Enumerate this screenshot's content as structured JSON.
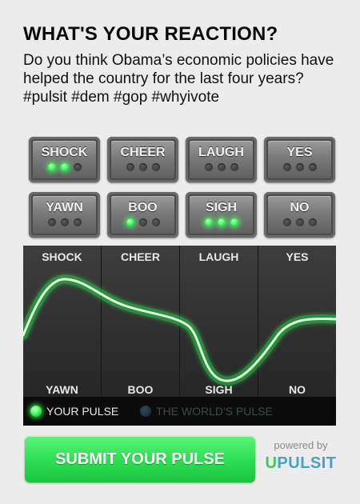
{
  "header": {
    "title": "WHAT'S YOUR REACTION?",
    "question": "Do you think Obama’s economic policies have helped the country for the last four years? #pulsit #dem #gop #whyivote"
  },
  "reactions": [
    {
      "label": "SHOCK",
      "lit": 2
    },
    {
      "label": "CHEER",
      "lit": 0
    },
    {
      "label": "LAUGH",
      "lit": 0
    },
    {
      "label": "YES",
      "lit": 0
    },
    {
      "label": "YAWN",
      "lit": 0
    },
    {
      "label": "BOO",
      "lit": 1
    },
    {
      "label": "SIGH",
      "lit": 3
    },
    {
      "label": "NO",
      "lit": 0
    }
  ],
  "pulse": {
    "top_labels": [
      "SHOCK",
      "CHEER",
      "LAUGH",
      "YES"
    ],
    "bottom_labels": [
      "YAWN",
      "BOO",
      "SIGH",
      "NO"
    ],
    "legend": {
      "your_pulse": "YOUR PULSE",
      "worlds_pulse": "THE WORLD'S PULSE"
    },
    "colors": {
      "your_pulse": "#3bff5a",
      "worlds_pulse": "#1f3a44",
      "panel": "#262626"
    }
  },
  "footer": {
    "submit_label": "SUBMIT YOUR PULSE",
    "powered_by": "powered by",
    "brand_u": "U",
    "brand_rest": "PULSIT"
  }
}
